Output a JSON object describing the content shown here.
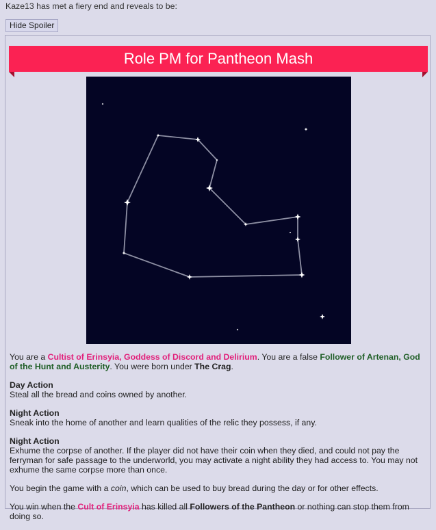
{
  "post": {
    "intro_text": "Kaze13 has met a fiery end and reveals to be:",
    "spoiler_button_label": "Hide Spoiler"
  },
  "banner": {
    "title": "Role PM for Pantheon Mash",
    "color": "#fb2253",
    "fold_color": "#a5102f"
  },
  "constellation": {
    "background_color": "#040524",
    "line_color": "#8d8fa3",
    "star_color": "#ffffff"
  },
  "role": {
    "line1": {
      "t1": "You are a ",
      "cultist": "Cultist of Erinsyia, Goddess of Discord and Delirium",
      "t2": ". You are a false ",
      "follower": "Follower of Artenan, God of the Hunt and Austerity",
      "t3": ". You were born under ",
      "sign": "The Crag",
      "t4": "."
    },
    "actions": [
      {
        "heading": "Day Action",
        "text": "Steal all the bread and coins owned by another."
      },
      {
        "heading": "Night Action",
        "text": "Sneak into the home of another and learn qualities of the relic they possess, if any."
      },
      {
        "heading": "Night Action",
        "text": "Exhume the corpse of another. If the player did not have their coin when they died, and could not pay the ferryman for safe passage to the underworld, you may activate a night ability they had access to. You may not exhume the same corpse more than once."
      }
    ],
    "coin_line": {
      "t1": "You begin the game with a ",
      "coin": "coin",
      "t2": ", which can be used to buy bread during the day or for other effects."
    },
    "win_line": {
      "t1": "You win when the ",
      "cult": "Cult of Erinsyia",
      "t2": " has killed all ",
      "followers": "Followers of the Pantheon",
      "t3": " or nothing can stop them from doing so."
    },
    "colors": {
      "cult": "#e21f7a",
      "false_follower": "#1f5e26"
    }
  }
}
